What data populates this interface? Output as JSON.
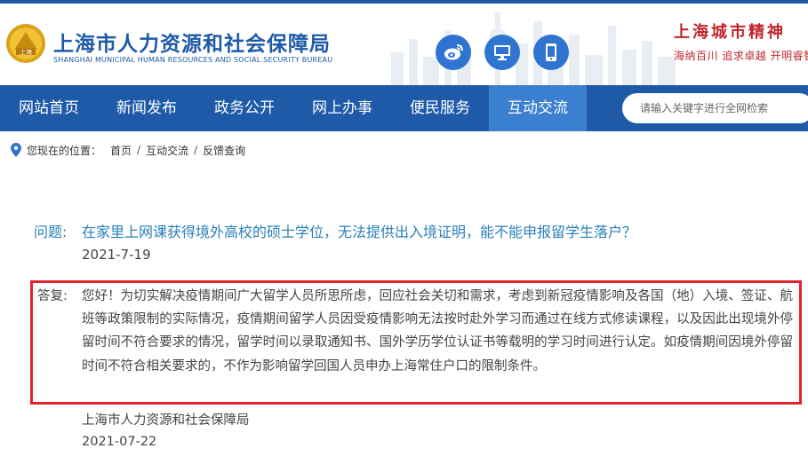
{
  "header": {
    "title": "上海市人力资源和社会保障局",
    "subtitle": "SHANGHAI MUNICIPAL HUMAN RESOURCES AND SOCIAL SECURITY BUREAU",
    "logo_text": "上海",
    "icons": [
      "weibo-icon",
      "desktop-icon",
      "mobile-icon"
    ],
    "spirit_title": "上海城市精神",
    "spirit_sub": "海纳百川  追求卓越  开明睿智"
  },
  "nav": {
    "items": [
      {
        "label": "网站首页"
      },
      {
        "label": "新闻发布"
      },
      {
        "label": "政务公开"
      },
      {
        "label": "网上办事"
      },
      {
        "label": "便民服务"
      },
      {
        "label": "互动交流"
      }
    ],
    "active_index": 5
  },
  "search": {
    "placeholder": "请输入关键字进行全网检索"
  },
  "breadcrumb": {
    "label": "您现在的位置：",
    "items": [
      "首页",
      "互动交流",
      "反馈查询"
    ],
    "separator": "/"
  },
  "question": {
    "label": "问题:",
    "text": "在家里上网课获得境外高校的硕士学位，无法提供出入境证明，能不能申报留学生落户？",
    "date": "2021-7-19"
  },
  "answer": {
    "label": "答复:",
    "text": "您好！为切实解决疫情期间广大留学人员所思所虑，回应社会关切和需求，考虑到新冠疫情影响及各国（地）入境、签证、航班等政策限制的实际情况，疫情期间留学人员因受疫情影响无法按时赴外学习而通过在线方式修读课程，以及因此出现境外停留时间不符合要求的情况，留学时间以录取通知书、国外学历学位认证书等载明的学习时间进行认定。如疫情期间因境外停留时间不符合相关要求的，不作为影响留学回国人员申办上海常住户口的限制条件。",
    "org": "上海市人力资源和社会保障局",
    "date": "2021-07-22"
  },
  "colors": {
    "brand_blue": "#1e5aa8",
    "active_tab": "#3a7fd0",
    "question_blue": "#2a7fb8",
    "highlight_red": "#e0242b",
    "spirit_red": "#c0262d"
  }
}
